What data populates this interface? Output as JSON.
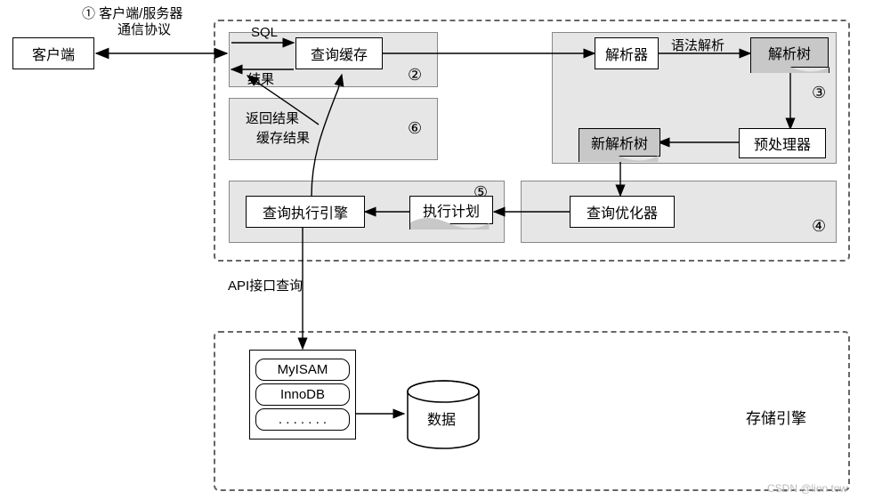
{
  "client": "客户端",
  "protocol_label_1": "① 客户端/服务器",
  "protocol_label_2": "通信协议",
  "sql_label": "SQL",
  "result_label": "结果",
  "query_cache": "查询缓存",
  "num2": "②",
  "return_result": "返回结果",
  "cache_result": "缓存结果",
  "num6": "⑥",
  "parser": "解析器",
  "syntax_parse": "语法解析",
  "parse_tree": "解析树",
  "num3": "③",
  "new_parse_tree": "新解析树",
  "preprocessor": "预处理器",
  "query_exec_engine": "查询执行引擎",
  "num5": "⑤",
  "exec_plan": "执行计划",
  "query_optimizer": "查询优化器",
  "num4": "④",
  "api_query": "API接口查询",
  "engine1": "MyISAM",
  "engine2": "InnoDB",
  "engine3": ". . . . . . .",
  "data": "数据",
  "storage_engine": "存储引擎",
  "watermark": "CSDN @lion tow"
}
